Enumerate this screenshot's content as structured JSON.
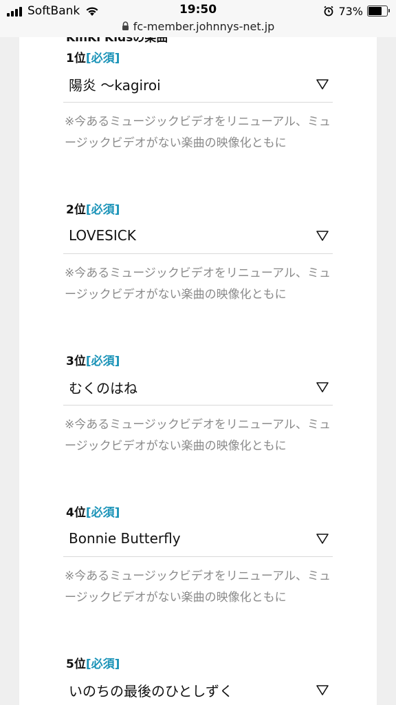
{
  "status_bar": {
    "carrier": "SoftBank",
    "time": "19:50",
    "battery_percent": "73%",
    "battery_level": 0.73
  },
  "url_bar": {
    "url": "fc-member.johnnys-net.jp"
  },
  "section": {
    "heading": "KinKi Kidsの楽曲"
  },
  "items": [
    {
      "rank": "1位",
      "required": "[必須]",
      "selected": "陽炎 〜kagiroi",
      "note": "※今あるミュージックビデオをリニューアル、ミュージックビデオがない楽曲の映像化ともに"
    },
    {
      "rank": "2位",
      "required": "[必須]",
      "selected": "LOVESICK",
      "note": "※今あるミュージックビデオをリニューアル、ミュージックビデオがない楽曲の映像化ともに"
    },
    {
      "rank": "3位",
      "required": "[必須]",
      "selected": "むくのはね",
      "note": "※今あるミュージックビデオをリニューアル、ミュージックビデオがない楽曲の映像化ともに"
    },
    {
      "rank": "4位",
      "required": "[必須]",
      "selected": "Bonnie Butterfly",
      "note": "※今あるミュージックビデオをリニューアル、ミュージックビデオがない楽曲の映像化ともに"
    },
    {
      "rank": "5位",
      "required": "[必須]",
      "selected": "いのちの最後のひとしずく",
      "note": ""
    }
  ],
  "colors": {
    "required_accent": "#1a93b8",
    "note_text": "#8a8a8a"
  }
}
